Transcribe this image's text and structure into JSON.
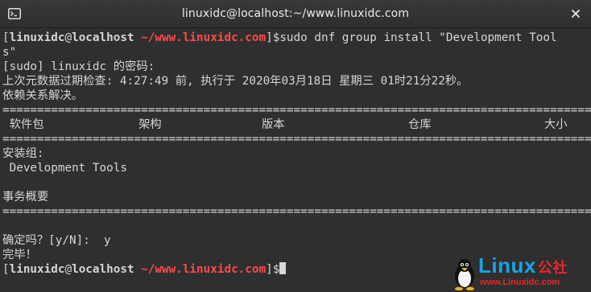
{
  "window": {
    "title": "linuxidc@localhost:~/www.linuxidc.com"
  },
  "icons": {
    "new_tab": "terminal-icon",
    "close": "close-icon"
  },
  "prompt": {
    "open": "[",
    "user": "linuxidc",
    "at": "@",
    "host": "localhost",
    "space": " ",
    "path": "~/www.linuxidc.com",
    "close": "]$"
  },
  "lines": {
    "command": "sudo dnf group install \"Development Tool",
    "command_wrap": "s\"",
    "sudo_prompt": "[sudo] linuxidc 的密码:",
    "metadata": "上次元数据过期检查: 4:27:49 前, 执行于 2020年03月18日 星期三 01时21分22秒。",
    "deps": "依赖关系解决。",
    "sep": "================================================================================================",
    "install_group": "安装组:",
    "group_name": " Development Tools",
    "blank": "",
    "summary": "事务概要",
    "confirm": "确定吗？[y/N]:  y",
    "done": "完毕！"
  },
  "table_headers": {
    "package": " 软件包",
    "arch": "架构",
    "version": "版本",
    "repo": "仓库",
    "size": "大小"
  },
  "watermark": {
    "brand": "Linux",
    "brand_cn": "公社",
    "url": "www.Linuxidc.com"
  },
  "colors": {
    "background": "#2f2f2f",
    "text": "#d6d6d6",
    "path": "#ff4a4a",
    "logo_blue": "#1aa3e8",
    "logo_red": "#e8252b"
  }
}
